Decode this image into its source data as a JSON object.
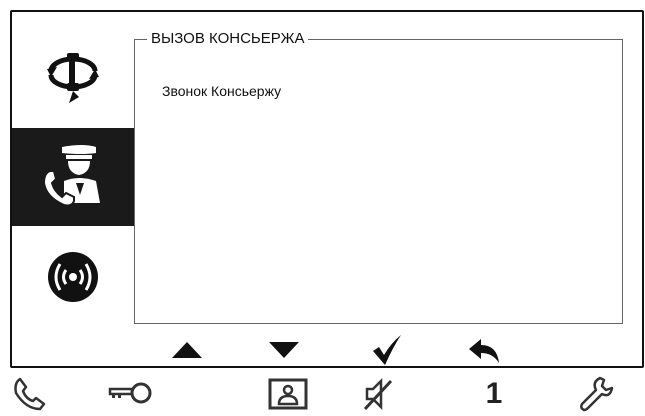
{
  "panel": {
    "title": "ВЫЗОВ КОНСЬЕРЖА",
    "item": "Звонок Консьержу"
  },
  "sidebar": {
    "items": [
      {
        "icon": "rotate-phone-icon",
        "selected": false
      },
      {
        "icon": "concierge-icon",
        "selected": true
      },
      {
        "icon": "broadcast-icon",
        "selected": false
      }
    ]
  },
  "nav": {
    "icons": [
      "arrow-up-icon",
      "arrow-down-icon",
      "checkmark-icon",
      "back-icon"
    ]
  },
  "bottom_bar": {
    "icons": [
      "phone-icon",
      "key-icon",
      "contact-card-icon",
      "mute-icon",
      "digit",
      "wrench-icon"
    ],
    "digit_label": "1"
  },
  "colors": {
    "dark": "#1a1a1a",
    "background": "#ffffff"
  }
}
